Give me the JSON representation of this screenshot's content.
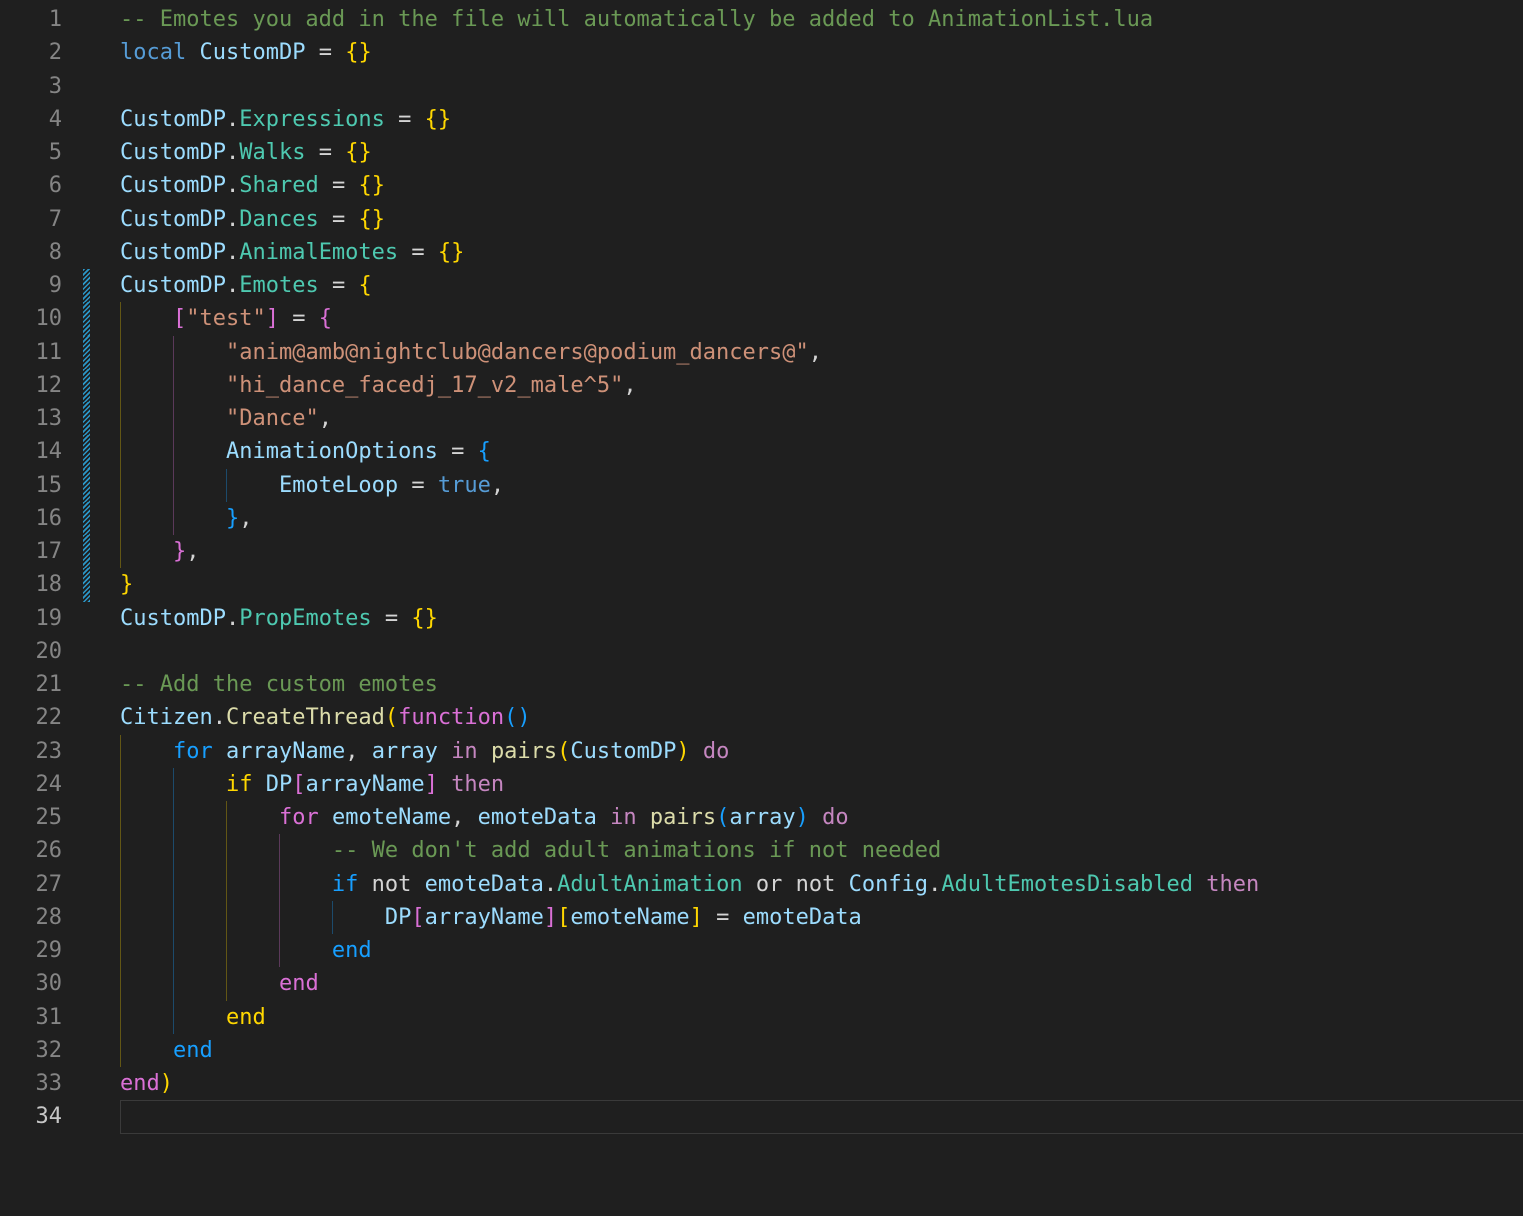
{
  "editor": {
    "app": "code-editor",
    "background": "#1F1F1F",
    "font_size_px": 22,
    "line_height_px": 33.25,
    "gutter": {
      "line_number_color": "#858585",
      "active_line_number_color": "#C6C6C6",
      "modified_indicator_color": "#2B97C8"
    },
    "active_line": 34,
    "active_line_border_color": "#3A3A3A",
    "token_colors": {
      "cm": "#6A9955",
      "kw": "#569CD6",
      "var": "#9CDCFE",
      "prop": "#4EC9B0",
      "fn": "#DCDCAA",
      "str": "#CE9178",
      "op": "#D4D4D4",
      "mag": "#C586C0",
      "g": "#FFD700",
      "p": "#DA70D6",
      "b": "#179FFF",
      "ws": "#D4D4D4"
    },
    "guide_colors": {
      "g": "rgba(255,215,0,0.30)",
      "p": "rgba(218,112,214,0.32)",
      "b": "rgba(23,159,255,0.34)"
    },
    "lines": [
      {
        "num": "1",
        "modified": false,
        "guides": [],
        "tokens": [
          [
            "cm",
            "-- Emotes you add in the file will automatically be added to AnimationList.lua"
          ]
        ]
      },
      {
        "num": "2",
        "modified": false,
        "guides": [],
        "tokens": [
          [
            "kw",
            "local"
          ],
          [
            "op",
            " "
          ],
          [
            "var",
            "CustomDP"
          ],
          [
            "op",
            " = "
          ],
          [
            "g",
            "{}"
          ]
        ]
      },
      {
        "num": "3",
        "modified": false,
        "guides": [],
        "tokens": []
      },
      {
        "num": "4",
        "modified": false,
        "guides": [],
        "tokens": [
          [
            "var",
            "CustomDP"
          ],
          [
            "op",
            "."
          ],
          [
            "prop",
            "Expressions"
          ],
          [
            "op",
            " = "
          ],
          [
            "g",
            "{}"
          ]
        ]
      },
      {
        "num": "5",
        "modified": false,
        "guides": [],
        "tokens": [
          [
            "var",
            "CustomDP"
          ],
          [
            "op",
            "."
          ],
          [
            "prop",
            "Walks"
          ],
          [
            "op",
            " = "
          ],
          [
            "g",
            "{}"
          ]
        ]
      },
      {
        "num": "6",
        "modified": false,
        "guides": [],
        "tokens": [
          [
            "var",
            "CustomDP"
          ],
          [
            "op",
            "."
          ],
          [
            "prop",
            "Shared"
          ],
          [
            "op",
            " = "
          ],
          [
            "g",
            "{}"
          ]
        ]
      },
      {
        "num": "7",
        "modified": false,
        "guides": [],
        "tokens": [
          [
            "var",
            "CustomDP"
          ],
          [
            "op",
            "."
          ],
          [
            "prop",
            "Dances"
          ],
          [
            "op",
            " = "
          ],
          [
            "g",
            "{}"
          ]
        ]
      },
      {
        "num": "8",
        "modified": false,
        "guides": [],
        "tokens": [
          [
            "var",
            "CustomDP"
          ],
          [
            "op",
            "."
          ],
          [
            "prop",
            "AnimalEmotes"
          ],
          [
            "op",
            " = "
          ],
          [
            "g",
            "{}"
          ]
        ]
      },
      {
        "num": "9",
        "modified": true,
        "guides": [],
        "tokens": [
          [
            "var",
            "CustomDP"
          ],
          [
            "op",
            "."
          ],
          [
            "prop",
            "Emotes"
          ],
          [
            "op",
            " = "
          ],
          [
            "g",
            "{"
          ]
        ]
      },
      {
        "num": "10",
        "modified": true,
        "guides": [
          [
            "g",
            0
          ]
        ],
        "tokens": [
          [
            "ws",
            "    "
          ],
          [
            "p",
            "["
          ],
          [
            "str",
            "\"test\""
          ],
          [
            "p",
            "]"
          ],
          [
            "op",
            " = "
          ],
          [
            "p",
            "{"
          ]
        ]
      },
      {
        "num": "11",
        "modified": true,
        "guides": [
          [
            "g",
            0
          ],
          [
            "p",
            4
          ]
        ],
        "tokens": [
          [
            "ws",
            "        "
          ],
          [
            "str",
            "\"anim@amb@nightclub@dancers@podium_dancers@\""
          ],
          [
            "op",
            ","
          ]
        ]
      },
      {
        "num": "12",
        "modified": true,
        "guides": [
          [
            "g",
            0
          ],
          [
            "p",
            4
          ]
        ],
        "tokens": [
          [
            "ws",
            "        "
          ],
          [
            "str",
            "\"hi_dance_facedj_17_v2_male^5\""
          ],
          [
            "op",
            ","
          ]
        ]
      },
      {
        "num": "13",
        "modified": true,
        "guides": [
          [
            "g",
            0
          ],
          [
            "p",
            4
          ]
        ],
        "tokens": [
          [
            "ws",
            "        "
          ],
          [
            "str",
            "\"Dance\""
          ],
          [
            "op",
            ","
          ]
        ]
      },
      {
        "num": "14",
        "modified": true,
        "guides": [
          [
            "g",
            0
          ],
          [
            "p",
            4
          ]
        ],
        "tokens": [
          [
            "ws",
            "        "
          ],
          [
            "var",
            "AnimationOptions"
          ],
          [
            "op",
            " = "
          ],
          [
            "b",
            "{"
          ]
        ]
      },
      {
        "num": "15",
        "modified": true,
        "guides": [
          [
            "g",
            0
          ],
          [
            "p",
            4
          ],
          [
            "b",
            8
          ]
        ],
        "tokens": [
          [
            "ws",
            "            "
          ],
          [
            "var",
            "EmoteLoop"
          ],
          [
            "op",
            " = "
          ],
          [
            "kw",
            "true"
          ],
          [
            "op",
            ","
          ]
        ]
      },
      {
        "num": "16",
        "modified": true,
        "guides": [
          [
            "g",
            0
          ],
          [
            "p",
            4
          ]
        ],
        "tokens": [
          [
            "ws",
            "        "
          ],
          [
            "b",
            "}"
          ],
          [
            "op",
            ","
          ]
        ]
      },
      {
        "num": "17",
        "modified": true,
        "guides": [
          [
            "g",
            0
          ]
        ],
        "tokens": [
          [
            "ws",
            "    "
          ],
          [
            "p",
            "}"
          ],
          [
            "op",
            ","
          ]
        ]
      },
      {
        "num": "18",
        "modified": true,
        "guides": [],
        "tokens": [
          [
            "g",
            "}"
          ]
        ]
      },
      {
        "num": "19",
        "modified": false,
        "guides": [],
        "tokens": [
          [
            "var",
            "CustomDP"
          ],
          [
            "op",
            "."
          ],
          [
            "prop",
            "PropEmotes"
          ],
          [
            "op",
            " = "
          ],
          [
            "g",
            "{}"
          ]
        ]
      },
      {
        "num": "20",
        "modified": false,
        "guides": [],
        "tokens": []
      },
      {
        "num": "21",
        "modified": false,
        "guides": [],
        "tokens": [
          [
            "cm",
            "-- Add the custom emotes"
          ]
        ]
      },
      {
        "num": "22",
        "modified": false,
        "guides": [],
        "tokens": [
          [
            "var",
            "Citizen"
          ],
          [
            "op",
            "."
          ],
          [
            "fn",
            "CreateThread"
          ],
          [
            "g",
            "("
          ],
          [
            "p",
            "function"
          ],
          [
            "b",
            "("
          ],
          [
            "b",
            ")"
          ]
        ]
      },
      {
        "num": "23",
        "modified": false,
        "guides": [
          [
            "g",
            0
          ]
        ],
        "tokens": [
          [
            "ws",
            "    "
          ],
          [
            "b",
            "for"
          ],
          [
            "op",
            " "
          ],
          [
            "var",
            "arrayName"
          ],
          [
            "op",
            ", "
          ],
          [
            "var",
            "array"
          ],
          [
            "op",
            " "
          ],
          [
            "mag",
            "in"
          ],
          [
            "op",
            " "
          ],
          [
            "fn",
            "pairs"
          ],
          [
            "g",
            "("
          ],
          [
            "var",
            "CustomDP"
          ],
          [
            "g",
            ")"
          ],
          [
            "op",
            " "
          ],
          [
            "mag",
            "do"
          ]
        ]
      },
      {
        "num": "24",
        "modified": false,
        "guides": [
          [
            "g",
            0
          ],
          [
            "b",
            4
          ]
        ],
        "tokens": [
          [
            "ws",
            "        "
          ],
          [
            "g",
            "if"
          ],
          [
            "op",
            " "
          ],
          [
            "var",
            "DP"
          ],
          [
            "p",
            "["
          ],
          [
            "var",
            "arrayName"
          ],
          [
            "p",
            "]"
          ],
          [
            "op",
            " "
          ],
          [
            "mag",
            "then"
          ]
        ]
      },
      {
        "num": "25",
        "modified": false,
        "guides": [
          [
            "g",
            0
          ],
          [
            "b",
            4
          ],
          [
            "g",
            8
          ]
        ],
        "tokens": [
          [
            "ws",
            "            "
          ],
          [
            "p",
            "for"
          ],
          [
            "op",
            " "
          ],
          [
            "var",
            "emoteName"
          ],
          [
            "op",
            ", "
          ],
          [
            "var",
            "emoteData"
          ],
          [
            "op",
            " "
          ],
          [
            "mag",
            "in"
          ],
          [
            "op",
            " "
          ],
          [
            "fn",
            "pairs"
          ],
          [
            "b",
            "("
          ],
          [
            "var",
            "array"
          ],
          [
            "b",
            ")"
          ],
          [
            "op",
            " "
          ],
          [
            "mag",
            "do"
          ]
        ]
      },
      {
        "num": "26",
        "modified": false,
        "guides": [
          [
            "g",
            0
          ],
          [
            "b",
            4
          ],
          [
            "g",
            8
          ],
          [
            "p",
            12
          ]
        ],
        "tokens": [
          [
            "ws",
            "                "
          ],
          [
            "cm",
            "-- We don't add adult animations if not needed"
          ]
        ]
      },
      {
        "num": "27",
        "modified": false,
        "guides": [
          [
            "g",
            0
          ],
          [
            "b",
            4
          ],
          [
            "g",
            8
          ],
          [
            "p",
            12
          ]
        ],
        "tokens": [
          [
            "ws",
            "                "
          ],
          [
            "b",
            "if"
          ],
          [
            "op",
            " "
          ],
          [
            "op",
            "not"
          ],
          [
            "op",
            " "
          ],
          [
            "var",
            "emoteData"
          ],
          [
            "op",
            "."
          ],
          [
            "prop",
            "AdultAnimation"
          ],
          [
            "op",
            " "
          ],
          [
            "op",
            "or"
          ],
          [
            "op",
            " "
          ],
          [
            "op",
            "not"
          ],
          [
            "op",
            " "
          ],
          [
            "var",
            "Config"
          ],
          [
            "op",
            "."
          ],
          [
            "prop",
            "AdultEmotesDisabled"
          ],
          [
            "op",
            " "
          ],
          [
            "mag",
            "then"
          ]
        ]
      },
      {
        "num": "28",
        "modified": false,
        "guides": [
          [
            "g",
            0
          ],
          [
            "b",
            4
          ],
          [
            "g",
            8
          ],
          [
            "p",
            12
          ],
          [
            "b",
            16
          ]
        ],
        "tokens": [
          [
            "ws",
            "                    "
          ],
          [
            "var",
            "DP"
          ],
          [
            "p",
            "["
          ],
          [
            "var",
            "arrayName"
          ],
          [
            "p",
            "]"
          ],
          [
            "g",
            "["
          ],
          [
            "var",
            "emoteName"
          ],
          [
            "g",
            "]"
          ],
          [
            "op",
            " = "
          ],
          [
            "var",
            "emoteData"
          ]
        ]
      },
      {
        "num": "29",
        "modified": false,
        "guides": [
          [
            "g",
            0
          ],
          [
            "b",
            4
          ],
          [
            "g",
            8
          ],
          [
            "p",
            12
          ]
        ],
        "tokens": [
          [
            "ws",
            "                "
          ],
          [
            "b",
            "end"
          ]
        ]
      },
      {
        "num": "30",
        "modified": false,
        "guides": [
          [
            "g",
            0
          ],
          [
            "b",
            4
          ],
          [
            "g",
            8
          ]
        ],
        "tokens": [
          [
            "ws",
            "            "
          ],
          [
            "p",
            "end"
          ]
        ]
      },
      {
        "num": "31",
        "modified": false,
        "guides": [
          [
            "g",
            0
          ],
          [
            "b",
            4
          ]
        ],
        "tokens": [
          [
            "ws",
            "        "
          ],
          [
            "g",
            "end"
          ]
        ]
      },
      {
        "num": "32",
        "modified": false,
        "guides": [
          [
            "g",
            0
          ]
        ],
        "tokens": [
          [
            "ws",
            "    "
          ],
          [
            "b",
            "end"
          ]
        ]
      },
      {
        "num": "33",
        "modified": false,
        "guides": [],
        "tokens": [
          [
            "p",
            "end"
          ],
          [
            "g",
            ")"
          ]
        ]
      },
      {
        "num": "34",
        "modified": false,
        "guides": [],
        "tokens": []
      }
    ]
  }
}
